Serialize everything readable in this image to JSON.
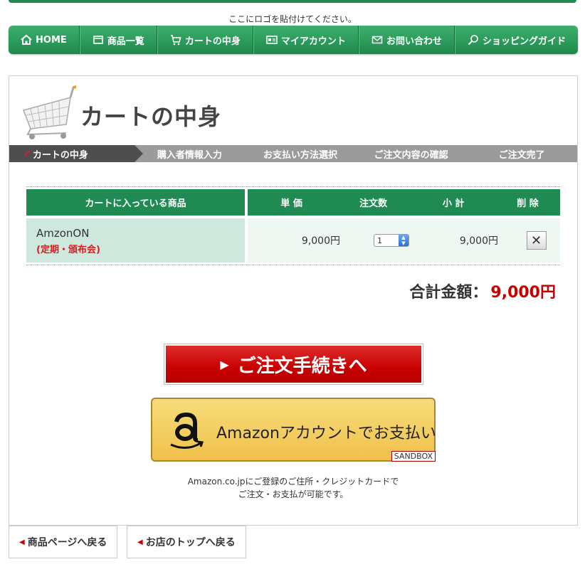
{
  "header": {
    "logo_placeholder": "ここにロゴを貼付けてください。"
  },
  "nav": {
    "items": [
      {
        "label": "HOME",
        "icon": "home-icon"
      },
      {
        "label": "商品一覧",
        "icon": "list-icon"
      },
      {
        "label": "カートの中身",
        "icon": "cart-icon"
      },
      {
        "label": "マイアカウント",
        "icon": "account-icon"
      },
      {
        "label": "お問い合わせ",
        "icon": "mail-icon"
      },
      {
        "label": "ショッピングガイド",
        "icon": "search-icon"
      }
    ]
  },
  "page": {
    "title": "カートの中身"
  },
  "steps": [
    {
      "label": "カートの中身",
      "active": true
    },
    {
      "label": "購入者情報入力"
    },
    {
      "label": "お支払い方法選択"
    },
    {
      "label": "ご注文内容の確認"
    },
    {
      "label": "ご注文完了"
    }
  ],
  "table": {
    "headers": {
      "product": "カートに入っている商品",
      "unit_price": "単 価",
      "quantity": "注文数",
      "subtotal": "小 計",
      "delete": "削 除"
    },
    "rows": [
      {
        "name": "AmzonON",
        "sub": "(定期・頒布会)",
        "unit_price": "9,000円",
        "quantity": "1",
        "subtotal": "9,000円"
      }
    ]
  },
  "total": {
    "label": "合計金額：",
    "amount": "9,000円"
  },
  "buttons": {
    "order": "ご注文手続きへ",
    "amazon": "Amazonアカウントでお支払い",
    "sandbox": "SANDBOX",
    "back_product": "商品ページへ戻る",
    "back_top": "お店のトップへ戻る"
  },
  "amazon_note": {
    "line1": "Amazon.co.jpにご登録のご住所・クレジットカードで",
    "line2": "ご注文・お支払が可能です。"
  },
  "colors": {
    "nav_green": "#1f8a52",
    "price_red": "#c40000",
    "order_red": "#c80000",
    "amazon_yellow": "#f0c14b"
  }
}
